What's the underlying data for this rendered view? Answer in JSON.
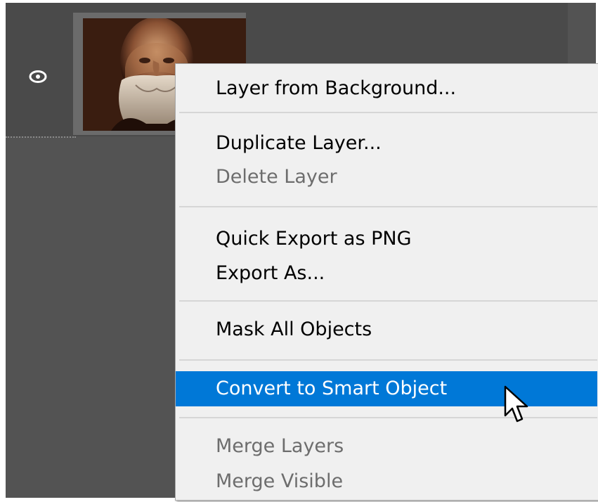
{
  "menu": {
    "items": [
      {
        "label": "Layer from Background...",
        "enabled": true
      },
      {
        "label": "Duplicate Layer...",
        "enabled": true
      },
      {
        "label": "Delete Layer",
        "enabled": false
      },
      {
        "label": "Quick Export as PNG",
        "enabled": true
      },
      {
        "label": "Export As...",
        "enabled": true
      },
      {
        "label": "Mask All Objects",
        "enabled": true
      },
      {
        "label": "Convert to Smart Object",
        "enabled": true,
        "highlighted": true
      },
      {
        "label": "Merge Layers",
        "enabled": false
      },
      {
        "label": "Merge Visible",
        "enabled": false
      }
    ]
  },
  "layer": {
    "visibility_icon": "eye-icon",
    "thumbnail": "layer-thumbnail-portrait"
  },
  "colors": {
    "panel_bg": "#535353",
    "menu_bg": "#f0f0f0",
    "highlight": "#0078d7",
    "disabled_text": "#6d6d6d"
  },
  "cursor": "arrow-pointer-icon"
}
